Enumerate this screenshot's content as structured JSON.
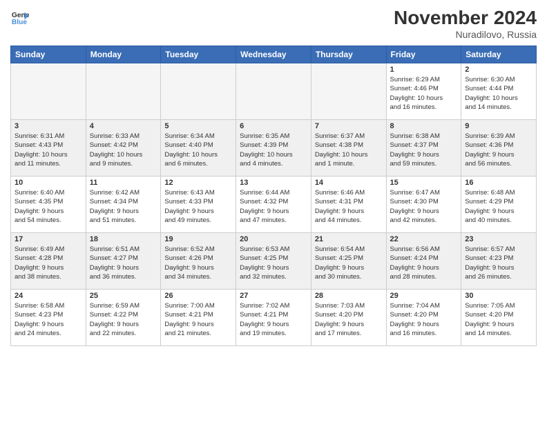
{
  "header": {
    "logo_line1": "General",
    "logo_line2": "Blue",
    "month": "November 2024",
    "location": "Nuradilovo, Russia"
  },
  "weekdays": [
    "Sunday",
    "Monday",
    "Tuesday",
    "Wednesday",
    "Thursday",
    "Friday",
    "Saturday"
  ],
  "weeks": [
    [
      {
        "day": "",
        "info": ""
      },
      {
        "day": "",
        "info": ""
      },
      {
        "day": "",
        "info": ""
      },
      {
        "day": "",
        "info": ""
      },
      {
        "day": "",
        "info": ""
      },
      {
        "day": "1",
        "info": "Sunrise: 6:29 AM\nSunset: 4:46 PM\nDaylight: 10 hours\nand 16 minutes."
      },
      {
        "day": "2",
        "info": "Sunrise: 6:30 AM\nSunset: 4:44 PM\nDaylight: 10 hours\nand 14 minutes."
      }
    ],
    [
      {
        "day": "3",
        "info": "Sunrise: 6:31 AM\nSunset: 4:43 PM\nDaylight: 10 hours\nand 11 minutes."
      },
      {
        "day": "4",
        "info": "Sunrise: 6:33 AM\nSunset: 4:42 PM\nDaylight: 10 hours\nand 9 minutes."
      },
      {
        "day": "5",
        "info": "Sunrise: 6:34 AM\nSunset: 4:40 PM\nDaylight: 10 hours\nand 6 minutes."
      },
      {
        "day": "6",
        "info": "Sunrise: 6:35 AM\nSunset: 4:39 PM\nDaylight: 10 hours\nand 4 minutes."
      },
      {
        "day": "7",
        "info": "Sunrise: 6:37 AM\nSunset: 4:38 PM\nDaylight: 10 hours\nand 1 minute."
      },
      {
        "day": "8",
        "info": "Sunrise: 6:38 AM\nSunset: 4:37 PM\nDaylight: 9 hours\nand 59 minutes."
      },
      {
        "day": "9",
        "info": "Sunrise: 6:39 AM\nSunset: 4:36 PM\nDaylight: 9 hours\nand 56 minutes."
      }
    ],
    [
      {
        "day": "10",
        "info": "Sunrise: 6:40 AM\nSunset: 4:35 PM\nDaylight: 9 hours\nand 54 minutes."
      },
      {
        "day": "11",
        "info": "Sunrise: 6:42 AM\nSunset: 4:34 PM\nDaylight: 9 hours\nand 51 minutes."
      },
      {
        "day": "12",
        "info": "Sunrise: 6:43 AM\nSunset: 4:33 PM\nDaylight: 9 hours\nand 49 minutes."
      },
      {
        "day": "13",
        "info": "Sunrise: 6:44 AM\nSunset: 4:32 PM\nDaylight: 9 hours\nand 47 minutes."
      },
      {
        "day": "14",
        "info": "Sunrise: 6:46 AM\nSunset: 4:31 PM\nDaylight: 9 hours\nand 44 minutes."
      },
      {
        "day": "15",
        "info": "Sunrise: 6:47 AM\nSunset: 4:30 PM\nDaylight: 9 hours\nand 42 minutes."
      },
      {
        "day": "16",
        "info": "Sunrise: 6:48 AM\nSunset: 4:29 PM\nDaylight: 9 hours\nand 40 minutes."
      }
    ],
    [
      {
        "day": "17",
        "info": "Sunrise: 6:49 AM\nSunset: 4:28 PM\nDaylight: 9 hours\nand 38 minutes."
      },
      {
        "day": "18",
        "info": "Sunrise: 6:51 AM\nSunset: 4:27 PM\nDaylight: 9 hours\nand 36 minutes."
      },
      {
        "day": "19",
        "info": "Sunrise: 6:52 AM\nSunset: 4:26 PM\nDaylight: 9 hours\nand 34 minutes."
      },
      {
        "day": "20",
        "info": "Sunrise: 6:53 AM\nSunset: 4:25 PM\nDaylight: 9 hours\nand 32 minutes."
      },
      {
        "day": "21",
        "info": "Sunrise: 6:54 AM\nSunset: 4:25 PM\nDaylight: 9 hours\nand 30 minutes."
      },
      {
        "day": "22",
        "info": "Sunrise: 6:56 AM\nSunset: 4:24 PM\nDaylight: 9 hours\nand 28 minutes."
      },
      {
        "day": "23",
        "info": "Sunrise: 6:57 AM\nSunset: 4:23 PM\nDaylight: 9 hours\nand 26 minutes."
      }
    ],
    [
      {
        "day": "24",
        "info": "Sunrise: 6:58 AM\nSunset: 4:23 PM\nDaylight: 9 hours\nand 24 minutes."
      },
      {
        "day": "25",
        "info": "Sunrise: 6:59 AM\nSunset: 4:22 PM\nDaylight: 9 hours\nand 22 minutes."
      },
      {
        "day": "26",
        "info": "Sunrise: 7:00 AM\nSunset: 4:21 PM\nDaylight: 9 hours\nand 21 minutes."
      },
      {
        "day": "27",
        "info": "Sunrise: 7:02 AM\nSunset: 4:21 PM\nDaylight: 9 hours\nand 19 minutes."
      },
      {
        "day": "28",
        "info": "Sunrise: 7:03 AM\nSunset: 4:20 PM\nDaylight: 9 hours\nand 17 minutes."
      },
      {
        "day": "29",
        "info": "Sunrise: 7:04 AM\nSunset: 4:20 PM\nDaylight: 9 hours\nand 16 minutes."
      },
      {
        "day": "30",
        "info": "Sunrise: 7:05 AM\nSunset: 4:20 PM\nDaylight: 9 hours\nand 14 minutes."
      }
    ]
  ]
}
